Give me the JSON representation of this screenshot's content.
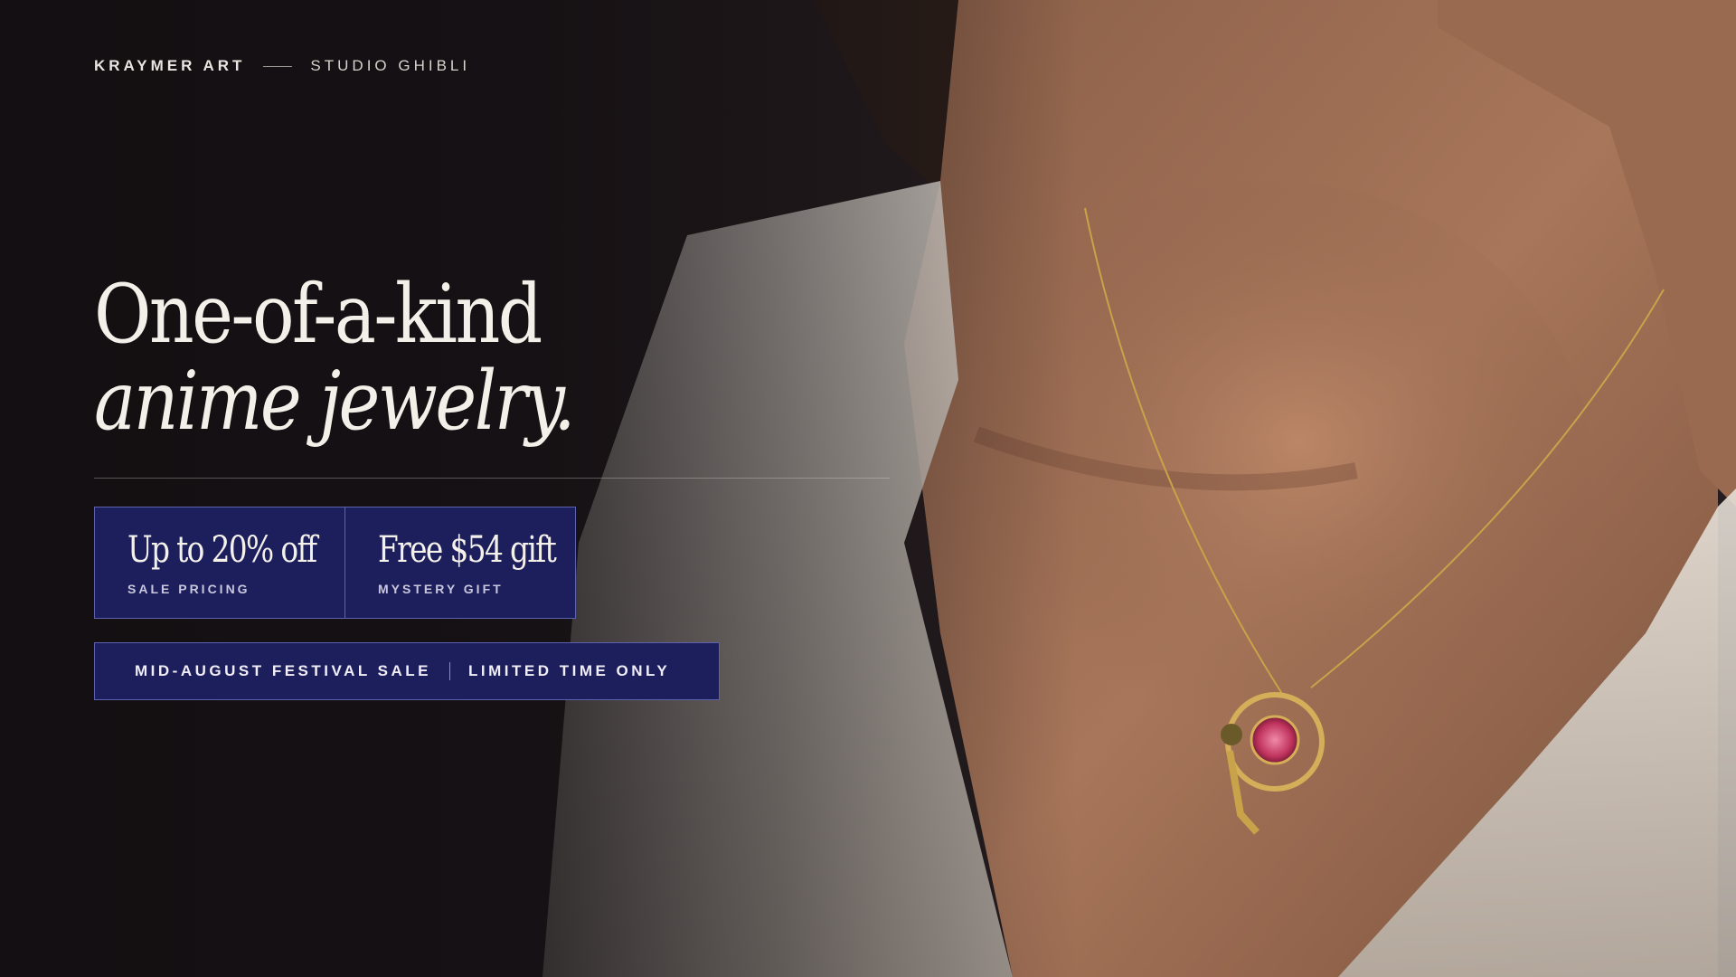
{
  "brand": {
    "name": "KRAYMER ART",
    "collection": "STUDIO GHIBLI"
  },
  "hero": {
    "line1": "One-of-a-kind",
    "line2": "anime jewelry."
  },
  "offers": [
    {
      "headline": "Up to 20% off",
      "label": "SALE PRICING"
    },
    {
      "headline": "Free $54 gift",
      "label": "MYSTERY GIFT"
    }
  ],
  "banner": {
    "left": "MID-AUGUST FESTIVAL SALE",
    "right": "LIMITED TIME ONLY"
  },
  "colors": {
    "background": "#1a1518",
    "offer_panel": "#1d1f5c",
    "text": "#f3efe9",
    "accent_border": "#5d62b0"
  }
}
